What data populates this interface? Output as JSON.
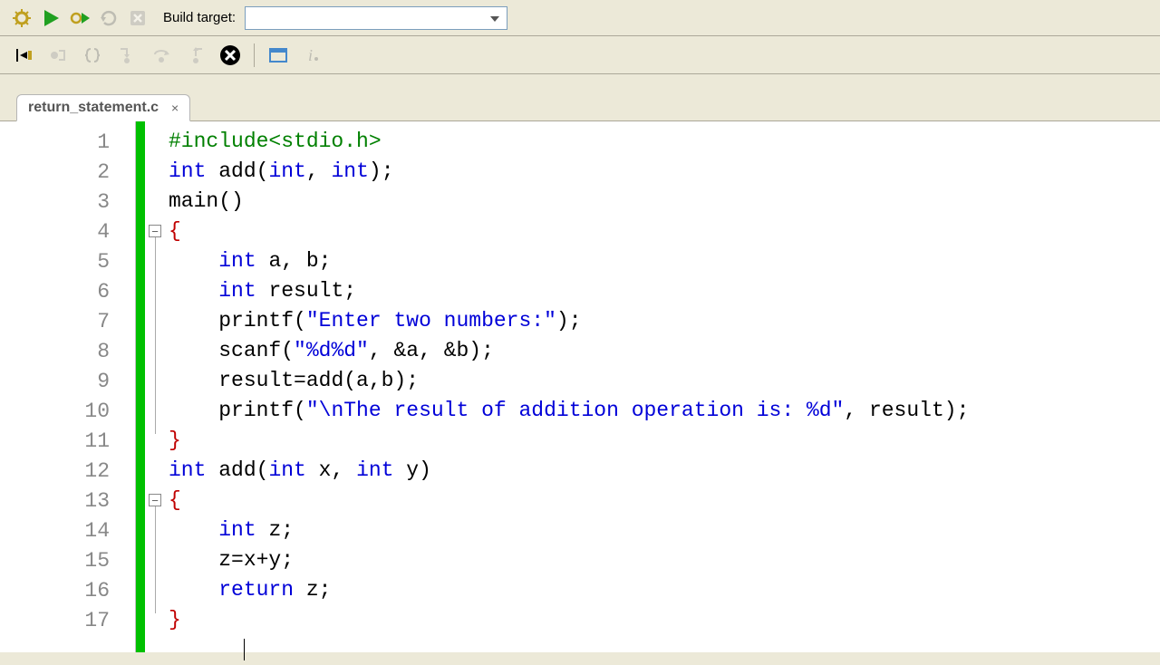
{
  "toolbar": {
    "build_target_label": "Build target:",
    "icons": {
      "build": "gear-icon",
      "run": "play-icon",
      "build_run": "gear-play-icon",
      "rebuild": "cycle-icon",
      "abort": "stop-icon"
    }
  },
  "toolbar2": {
    "icons": [
      "debug-step-icon",
      "breakpoint-icon",
      "braces-icon",
      "step-into-icon",
      "step-over-icon",
      "step-out-icon",
      "stop-debug-icon",
      "window-icon",
      "info-icon"
    ]
  },
  "tab": {
    "name": "return_statement.c",
    "close": "×"
  },
  "editor": {
    "lines": [
      {
        "n": "1",
        "indent": "",
        "tokens": [
          {
            "cls": "green",
            "t": "#include<stdio.h>"
          }
        ]
      },
      {
        "n": "2",
        "indent": "",
        "tokens": [
          {
            "cls": "blue",
            "t": "int"
          },
          {
            "cls": "black",
            "t": " add("
          },
          {
            "cls": "blue",
            "t": "int"
          },
          {
            "cls": "black",
            "t": ", "
          },
          {
            "cls": "blue",
            "t": "int"
          },
          {
            "cls": "black",
            "t": ");"
          }
        ]
      },
      {
        "n": "3",
        "indent": "",
        "tokens": [
          {
            "cls": "black",
            "t": "main()"
          }
        ]
      },
      {
        "n": "4",
        "indent": "",
        "tokens": [
          {
            "cls": "red",
            "t": "{"
          }
        ],
        "fold": true
      },
      {
        "n": "5",
        "indent": "    ",
        "tokens": [
          {
            "cls": "blue",
            "t": "int"
          },
          {
            "cls": "black",
            "t": " a, b;"
          }
        ]
      },
      {
        "n": "6",
        "indent": "    ",
        "tokens": [
          {
            "cls": "blue",
            "t": "int"
          },
          {
            "cls": "black",
            "t": " result;"
          }
        ]
      },
      {
        "n": "7",
        "indent": "    ",
        "tokens": [
          {
            "cls": "black",
            "t": "printf("
          },
          {
            "cls": "blue",
            "t": "\"Enter two numbers:\""
          },
          {
            "cls": "black",
            "t": ");"
          }
        ]
      },
      {
        "n": "8",
        "indent": "    ",
        "tokens": [
          {
            "cls": "black",
            "t": "scanf("
          },
          {
            "cls": "blue",
            "t": "\"%d%d\""
          },
          {
            "cls": "black",
            "t": ", &a, &b);"
          }
        ]
      },
      {
        "n": "9",
        "indent": "    ",
        "tokens": [
          {
            "cls": "black",
            "t": "result=add(a,b);"
          }
        ]
      },
      {
        "n": "10",
        "indent": "    ",
        "tokens": [
          {
            "cls": "black",
            "t": "printf("
          },
          {
            "cls": "blue",
            "t": "\"\\nThe result of addition operation is: %d\""
          },
          {
            "cls": "black",
            "t": ", result);"
          }
        ]
      },
      {
        "n": "11",
        "indent": "",
        "tokens": [
          {
            "cls": "red",
            "t": "}"
          }
        ]
      },
      {
        "n": "12",
        "indent": "",
        "tokens": [
          {
            "cls": "blue",
            "t": "int"
          },
          {
            "cls": "black",
            "t": " add("
          },
          {
            "cls": "blue",
            "t": "int"
          },
          {
            "cls": "black",
            "t": " x, "
          },
          {
            "cls": "blue",
            "t": "int"
          },
          {
            "cls": "black",
            "t": " y)"
          }
        ]
      },
      {
        "n": "13",
        "indent": "",
        "tokens": [
          {
            "cls": "red",
            "t": "{"
          }
        ],
        "fold": true
      },
      {
        "n": "14",
        "indent": "    ",
        "tokens": [
          {
            "cls": "blue",
            "t": "int"
          },
          {
            "cls": "black",
            "t": " z;"
          }
        ]
      },
      {
        "n": "15",
        "indent": "    ",
        "tokens": [
          {
            "cls": "black",
            "t": "z=x+y;"
          }
        ]
      },
      {
        "n": "16",
        "indent": "    ",
        "tokens": [
          {
            "cls": "blue",
            "t": "return"
          },
          {
            "cls": "black",
            "t": " z;"
          }
        ]
      },
      {
        "n": "17",
        "indent": "",
        "tokens": [
          {
            "cls": "red",
            "t": "}"
          }
        ]
      }
    ]
  }
}
